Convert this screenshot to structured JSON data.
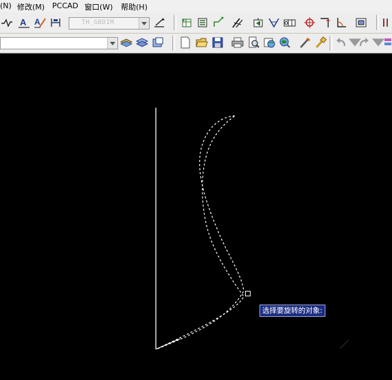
{
  "menubar": {
    "items": [
      "(N)",
      "修改(M)",
      "PCCAD",
      "窗口(W)",
      "帮助(H)"
    ]
  },
  "toolbar": {
    "dimstyle_value": "TH_GBDIM",
    "layer_combo_value": ""
  },
  "icons": {
    "row1": [
      "linear-dim-icon",
      "text-style-icon",
      "leader-icon",
      "dim-break-icon",
      "dim-style-update-icon",
      "balloon-icon",
      "table-icon",
      "polyline-edit-icon",
      "trim-icon",
      "block-insert-icon",
      "surface-finish-icon",
      "tolerance-icon",
      "datum-icon",
      "center-mark-icon",
      "angle-dim-icon",
      "frame-icon"
    ],
    "row2": [
      "layer-manager-icon",
      "layer-state-icon",
      "layer-iso-icon",
      "new-file-icon",
      "open-file-icon",
      "save-icon",
      "print-icon",
      "preview-icon",
      "publish-icon",
      "design-center-icon",
      "match-prop-icon",
      "brush-icon",
      "undo-icon",
      "redo-icon"
    ]
  },
  "command_prompt": {
    "text": "选择要旋转的对象:"
  },
  "colors": {
    "canvas": "#000000",
    "prompt_bg": "#1c2d82",
    "entity": "#ffffff"
  }
}
